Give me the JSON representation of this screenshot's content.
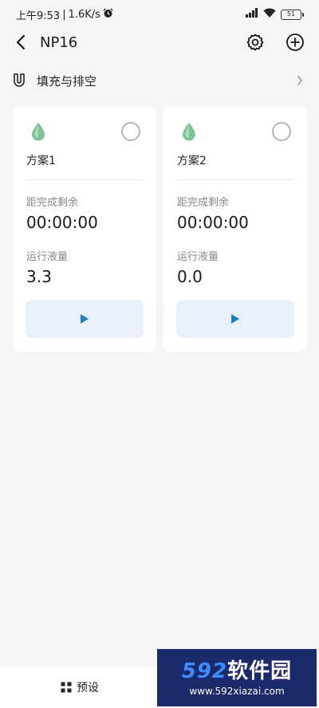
{
  "status": {
    "time": "上午9:53",
    "speed": "1.6K/s",
    "battery": "51"
  },
  "nav": {
    "title": "NP16"
  },
  "fill_row": {
    "label": "填充与排空"
  },
  "plans": [
    {
      "name": "方案1",
      "remaining_label": "距完成剩余",
      "remaining": "00:00:00",
      "volume_label": "运行液量",
      "volume": "3.3"
    },
    {
      "name": "方案2",
      "remaining_label": "距完成剩余",
      "remaining": "00:00:00",
      "volume_label": "运行液量",
      "volume": "0.0"
    }
  ],
  "bottom_nav": {
    "preset_label": "预设"
  },
  "watermark": {
    "brand_num": "592",
    "brand_text": "软件园",
    "url": "www.592xiazai.com"
  },
  "colors": {
    "accent": "#1a7fc4",
    "drop_green": "#6fbf8b",
    "play_bg": "#e8f1fb"
  }
}
